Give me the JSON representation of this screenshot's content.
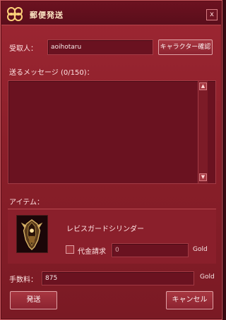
{
  "window": {
    "title": "郵便発送",
    "close_glyph": "x"
  },
  "recipient": {
    "label": "受取人：",
    "value": "aoihotaru",
    "check_button": "キャラクター確認"
  },
  "message": {
    "label": "送るメッセージ (0/150)：",
    "value": ""
  },
  "item": {
    "label": "アイテム：",
    "name": "レビスガードシリンダー",
    "cod_label": "代金請求",
    "cod_value": "0",
    "cod_unit": "Gold"
  },
  "fee": {
    "label": "手数料：",
    "value": "875",
    "unit": "Gold"
  },
  "actions": {
    "send": "発送",
    "cancel": "キャンセル"
  },
  "colors": {
    "background": "#8b1f2a",
    "accent": "#e1a2a6",
    "title_text": "#ffe9c7"
  },
  "icons": {
    "window_icon": "ornament-icon",
    "item_icon": "armor-icon"
  }
}
